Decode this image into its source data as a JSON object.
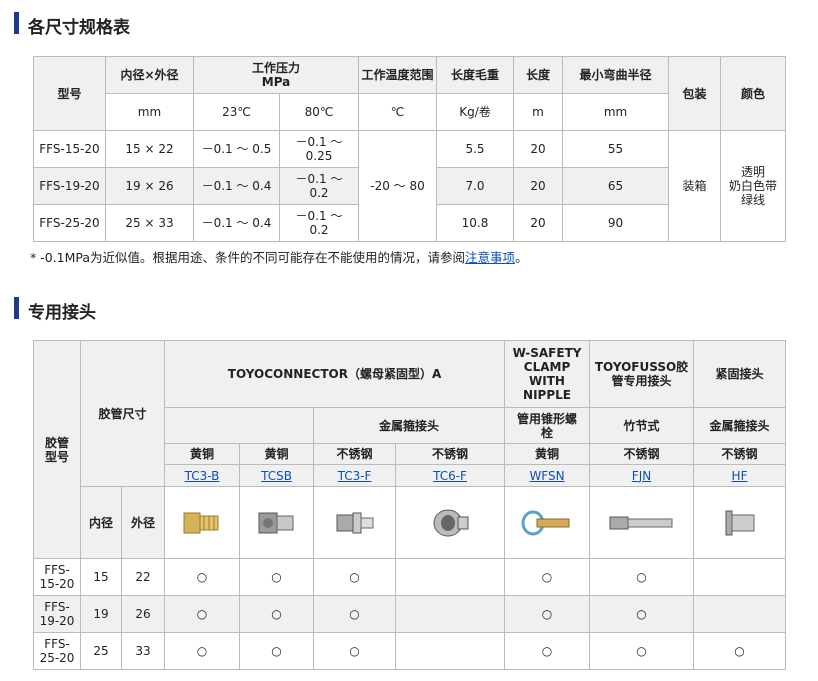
{
  "section1": {
    "title": "各尺寸规格表",
    "headers": {
      "model": "型号",
      "diam": "内径×外径",
      "pressure": "工作压力\nMPa",
      "temp": "工作温度范围",
      "weight": "长度毛重",
      "length": "长度",
      "bend": "最小弯曲半径",
      "pack": "包装",
      "color": "颜色"
    },
    "units": {
      "diam": "mm",
      "p23": "23℃",
      "p80": "80℃",
      "temp": "℃",
      "weight": "Kg/卷",
      "length": "m",
      "bend": "mm"
    },
    "rows": [
      {
        "model": "FFS-15-20",
        "diam": "15 × 22",
        "p23": "－0.1 ～ 0.5",
        "p80": "－0.1 ～\n0.25",
        "weight": "5.5",
        "length": "20",
        "bend": "55"
      },
      {
        "model": "FFS-19-20",
        "diam": "19 × 26",
        "p23": "－0.1 ～ 0.4",
        "p80": "－0.1 ～\n0.2",
        "weight": "7.0",
        "length": "20",
        "bend": "65"
      },
      {
        "model": "FFS-25-20",
        "diam": "25 × 33",
        "p23": "－0.1 ～ 0.4",
        "p80": "－0.1 ～\n0.2",
        "weight": "10.8",
        "length": "20",
        "bend": "90"
      }
    ],
    "temp_range": "-20 ～ 80",
    "pack": "装箱",
    "color": "透明\n奶白色带\n绿线",
    "note_prefix": "* -0.1MPa为近似值。根据用途、条件的不同可能存在不能使用的情况，请参阅",
    "note_link": "注意事项",
    "note_suffix": "。"
  },
  "section2": {
    "title": "专用接头",
    "headers": {
      "hose_model": "胶管\n型号",
      "hose_size": "胶管尺寸",
      "toyoconnector": "TOYOCONNECTOR（螺母紧固型）A",
      "wsafety": "W-SAFETY\nCLAMP\nWITH\nNIPPLE",
      "toyofusso": "TOYOFUSSO胶\n管专用接头",
      "tight": "紧固接头",
      "metal_clamp": "金属箍接头",
      "pipe_taper": "管用锥形螺\n栓",
      "bamboo": "竹节式",
      "metal_clamp2": "金属箍接头",
      "inner": "内径",
      "outer": "外径"
    },
    "materials": [
      "黄铜",
      "黄铜",
      "不锈钢",
      "不锈钢",
      "黄铜",
      "不锈钢",
      "不锈钢"
    ],
    "codes": [
      "TC3-B",
      "TCSB",
      "TC3-F",
      "TC6-F",
      "WFSN",
      "FJN",
      "HF"
    ],
    "rows": [
      {
        "model": "FFS-\n15-20",
        "inner": "15",
        "outer": "22",
        "marks": [
          "○",
          "○",
          "○",
          "",
          "○",
          "○",
          ""
        ]
      },
      {
        "model": "FFS-\n19-20",
        "inner": "19",
        "outer": "26",
        "marks": [
          "○",
          "○",
          "○",
          "",
          "○",
          "○",
          ""
        ]
      },
      {
        "model": "FFS-\n25-20",
        "inner": "25",
        "outer": "33",
        "marks": [
          "○",
          "○",
          "○",
          "",
          "○",
          "○",
          "○"
        ]
      }
    ]
  }
}
